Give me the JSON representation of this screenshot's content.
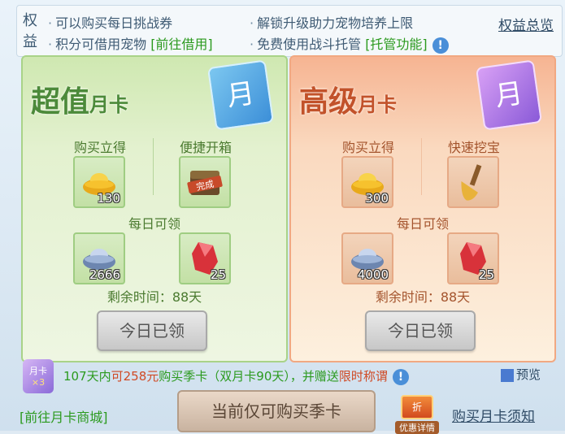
{
  "benefits": {
    "title": "权益",
    "items": [
      {
        "text": "可以购买每日挑战券",
        "link": ""
      },
      {
        "text": "解锁升级助力宠物培养上限",
        "link": ""
      },
      {
        "text": "积分可借用宠物 ",
        "link": "[前往借用]"
      },
      {
        "text": "免费使用战斗托管 ",
        "link": "[托管功能]"
      }
    ],
    "overview_label": "权益总览"
  },
  "cards": [
    {
      "title_main": "超值",
      "title_sub": "月卡",
      "badge": "月",
      "col1_label": "购买立得",
      "col2_label": "便捷开箱",
      "instant": [
        {
          "icon": "gold-ingot-icon",
          "count": "130"
        },
        {
          "icon": "chest-complete-icon",
          "count": "",
          "stamp": "完成"
        }
      ],
      "daily_label": "每日可领",
      "daily": [
        {
          "icon": "silver-ingot-icon",
          "count": "2666"
        },
        {
          "icon": "red-gem-icon",
          "count": "25"
        }
      ],
      "remaining": "剩余时间：88天",
      "button": "今日已领"
    },
    {
      "title_main": "高级",
      "title_sub": "月卡",
      "badge": "月",
      "col1_label": "购买立得",
      "col2_label": "快速挖宝",
      "instant": [
        {
          "icon": "gold-ingot-icon",
          "count": "300"
        },
        {
          "icon": "shovel-icon",
          "count": ""
        }
      ],
      "daily_label": "每日可领",
      "daily": [
        {
          "icon": "silver-ingot-icon",
          "count": "4000"
        },
        {
          "icon": "red-gem-icon",
          "count": "25"
        }
      ],
      "remaining": "剩余时间：88天",
      "button": "今日已领"
    }
  ],
  "bottom": {
    "promo_icon_text": "月卡",
    "promo_icon_count": "×3",
    "promo_part1": "107天内",
    "promo_part2": "可258元",
    "promo_part3": "购买季卡（双月卡90天），并赠送",
    "promo_part4": "限时称谓",
    "preview_label": "预览",
    "mall_link": "[前往月卡商城]",
    "quarter_button": "当前仅可购买季卡",
    "deal_badge": "折",
    "deal_label": "优惠详情",
    "notice_link": "购买月卡须知"
  },
  "colors": {
    "green_accent": "#4c8a3a",
    "orange_accent": "#c2522a",
    "link_green": "#2b9a1e"
  }
}
